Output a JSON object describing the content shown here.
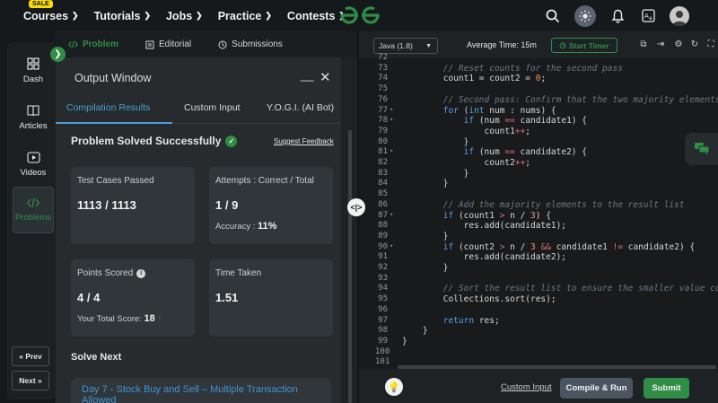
{
  "nav": {
    "sale_badge": "SALE",
    "items": [
      {
        "label": "Courses"
      },
      {
        "label": "Tutorials"
      },
      {
        "label": "Jobs"
      },
      {
        "label": "Practice"
      },
      {
        "label": "Contests"
      }
    ],
    "icons": [
      "search-icon",
      "theme-toggle-icon",
      "bell-icon",
      "translate-icon",
      "avatar"
    ]
  },
  "rail": {
    "items": [
      {
        "label": "Dash",
        "icon": "dashboard-icon"
      },
      {
        "label": "Articles",
        "icon": "book-icon"
      },
      {
        "label": "Videos",
        "icon": "play-icon"
      },
      {
        "label": "Problems",
        "icon": "code-icon",
        "active": true
      }
    ],
    "prev_label": "« Prev",
    "next_label": "Next »"
  },
  "problem_tabs": [
    {
      "label": "Problem",
      "icon": "code-icon",
      "active": true
    },
    {
      "label": "Editorial",
      "icon": "editorial-icon"
    },
    {
      "label": "Submissions",
      "icon": "clock-icon"
    }
  ],
  "output": {
    "title": "Output Window",
    "tabs": [
      "Compilation Results",
      "Custom Input",
      "Y.O.G.I. (AI Bot)"
    ],
    "status": "Problem Solved Successfully",
    "suggest_feedback": "Suggest Feedback",
    "cards": {
      "test_cases_label": "Test Cases Passed",
      "test_cases_value": "1113 / 1113",
      "attempts_label": "Attempts : Correct / Total",
      "attempts_value": "1 / 9",
      "accuracy_label": "Accuracy :",
      "accuracy_value": "11%",
      "points_label": "Points Scored",
      "points_value": "4 / 4",
      "total_score_label": "Your Total Score:",
      "total_score_value": "18",
      "time_label": "Time Taken",
      "time_value": "1.51"
    },
    "solve_next": "Solve Next",
    "next_problem": "Day 7 - Stock Buy and Sell – Multiple Transaction Allowed"
  },
  "editor": {
    "language": "Java (1.8)",
    "average_time": "Average Time: 15m",
    "start_timer": "Start Timer",
    "lines": [
      {
        "n": "72",
        "text": ""
      },
      {
        "n": "73",
        "text": "        // Reset counts for the second pass",
        "kind": "comment"
      },
      {
        "n": "74",
        "text": "        count1 = count2 = 0;"
      },
      {
        "n": "75",
        "text": ""
      },
      {
        "n": "76",
        "text": "        // Second pass: Confirm that the two majority elements",
        "kind": "comment"
      },
      {
        "n": "77",
        "text": "        for (int num : nums) {",
        "fold": true
      },
      {
        "n": "78",
        "text": "            if (num == candidate1) {",
        "fold": true
      },
      {
        "n": "79",
        "text": "                count1++;"
      },
      {
        "n": "80",
        "text": "            }"
      },
      {
        "n": "81",
        "text": "            if (num == candidate2) {",
        "fold": true
      },
      {
        "n": "82",
        "text": "                count2++;"
      },
      {
        "n": "83",
        "text": "            }"
      },
      {
        "n": "84",
        "text": "        }"
      },
      {
        "n": "85",
        "text": ""
      },
      {
        "n": "86",
        "text": "        // Add the majority elements to the result list",
        "kind": "comment"
      },
      {
        "n": "87",
        "text": "        if (count1 > n / 3) {",
        "fold": true
      },
      {
        "n": "88",
        "text": "            res.add(candidate1);"
      },
      {
        "n": "89",
        "text": "        }"
      },
      {
        "n": "90",
        "text": "        if (count2 > n / 3 && candidate1 != candidate2) {",
        "fold": true
      },
      {
        "n": "91",
        "text": "            res.add(candidate2);"
      },
      {
        "n": "92",
        "text": "        }"
      },
      {
        "n": "93",
        "text": ""
      },
      {
        "n": "94",
        "text": "        // Sort the result list to ensure the smaller value co",
        "kind": "comment"
      },
      {
        "n": "95",
        "text": "        Collections.sort(res);"
      },
      {
        "n": "96",
        "text": ""
      },
      {
        "n": "97",
        "text": "        return res;"
      },
      {
        "n": "98",
        "text": "    }"
      },
      {
        "n": "99",
        "text": "}"
      },
      {
        "n": "100",
        "text": ""
      },
      {
        "n": "101",
        "text": ""
      }
    ],
    "custom_input": "Custom Input",
    "compile_run": "Compile & Run",
    "submit": "Submit"
  },
  "colors": {
    "accent_green": "#2f8d46",
    "link_blue": "#4b9fd6"
  }
}
